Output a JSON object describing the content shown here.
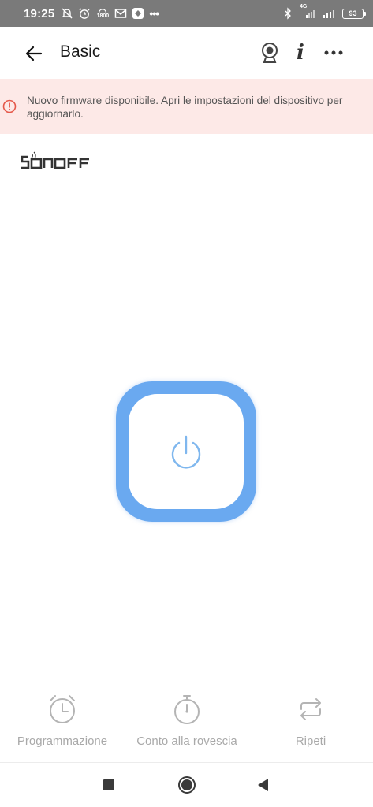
{
  "status_bar": {
    "time": "19:25",
    "left_icons": [
      "bell-off-icon",
      "alarm-icon",
      "speed-1800-icon",
      "gmail-icon",
      "app-icon"
    ],
    "overflow": "•••",
    "right_icons": [
      "bluetooth-icon",
      "signal-4g-icon",
      "signal-icon"
    ],
    "network": "4G",
    "speed_label": "1800",
    "battery": "93"
  },
  "appbar": {
    "title": "Basic",
    "icons": [
      "back-arrow-icon",
      "camera-icon",
      "info-icon",
      "more-icon"
    ],
    "info_glyph": "i"
  },
  "banner": {
    "message": "Nuovo firmware disponibile. Apri le impostazioni del dispositivo per aggiornarlo.",
    "icon": "alert-circle-icon",
    "color": "#fde9e7",
    "icon_color": "#e5584a"
  },
  "brand": {
    "logo": "SONOFF"
  },
  "power": {
    "icon": "power-icon",
    "ring_color": "#6aa9f0",
    "icon_color": "#7fb7ee"
  },
  "actions": [
    {
      "label": "Programmazione",
      "icon": "alarm-clock-icon"
    },
    {
      "label": "Conto alla rovescia",
      "icon": "stopwatch-icon"
    },
    {
      "label": "Ripeti",
      "icon": "repeat-icon"
    }
  ],
  "navbar": {
    "icons": [
      "recent-apps-icon",
      "home-icon",
      "back-icon"
    ]
  }
}
